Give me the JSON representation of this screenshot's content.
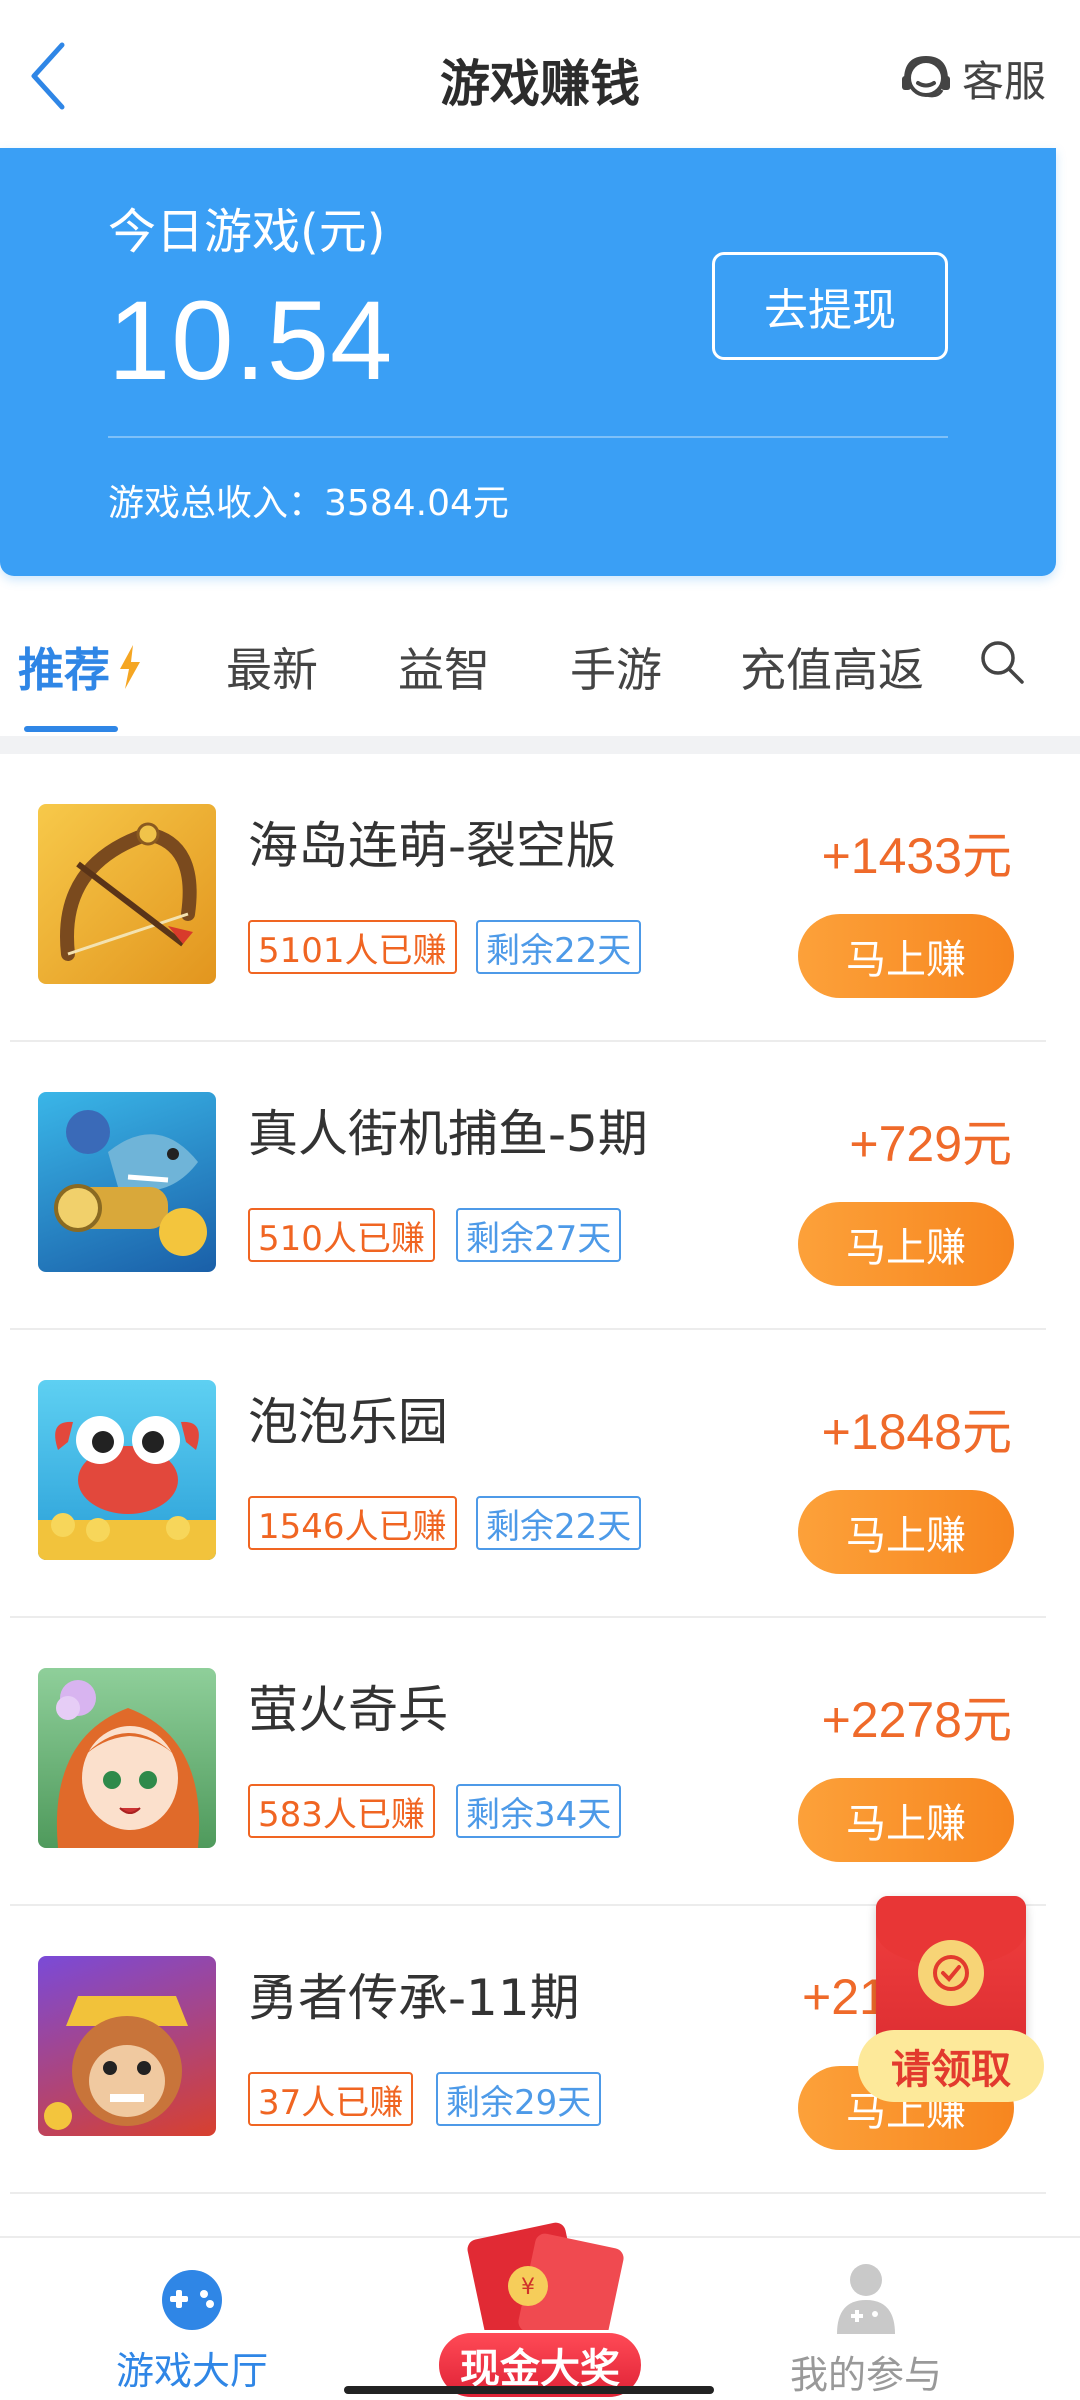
{
  "header": {
    "title": "游戏赚钱",
    "service_label": "客服"
  },
  "earnings": {
    "today_label": "今日游戏(元)",
    "today_value": "10.54",
    "withdraw_label": "去提现",
    "total_label": "游戏总收入：",
    "total_value": "3584.04元"
  },
  "tabs": [
    {
      "label": "推荐",
      "active": true
    },
    {
      "label": "最新",
      "active": false
    },
    {
      "label": "益智",
      "active": false
    },
    {
      "label": "手游",
      "active": false
    },
    {
      "label": "充值高返",
      "active": false
    }
  ],
  "games": [
    {
      "name": "海岛连萌-裂空版",
      "earned": "5101人已赚",
      "remain": "剩余22天",
      "reward": "+1433元",
      "button": "马上赚"
    },
    {
      "name": "真人街机捕鱼-5期",
      "earned": "510人已赚",
      "remain": "剩余27天",
      "reward": "+729元",
      "button": "马上赚"
    },
    {
      "name": "泡泡乐园",
      "earned": "1546人已赚",
      "remain": "剩余22天",
      "reward": "+1848元",
      "button": "马上赚"
    },
    {
      "name": "萤火奇兵",
      "earned": "583人已赚",
      "remain": "剩余34天",
      "reward": "+2278元",
      "button": "马上赚"
    },
    {
      "name": "勇者传承-11期",
      "earned": "37人已赚",
      "remain": "剩余29天",
      "reward": "+21",
      "button": "马上赚"
    }
  ],
  "floating_packet": {
    "label": "请领取"
  },
  "bottom_nav": {
    "hall_label": "游戏大厅",
    "cash_label": "现金大奖",
    "mine_label": "我的参与"
  },
  "colors": {
    "primary_blue": "#3a9ff5",
    "tab_active": "#2f86e6",
    "reward_orange": "#ef6a2a",
    "button_orange": "#f7861f",
    "badge_blue": "#4d9ae8",
    "badge_red": "#f06522"
  }
}
